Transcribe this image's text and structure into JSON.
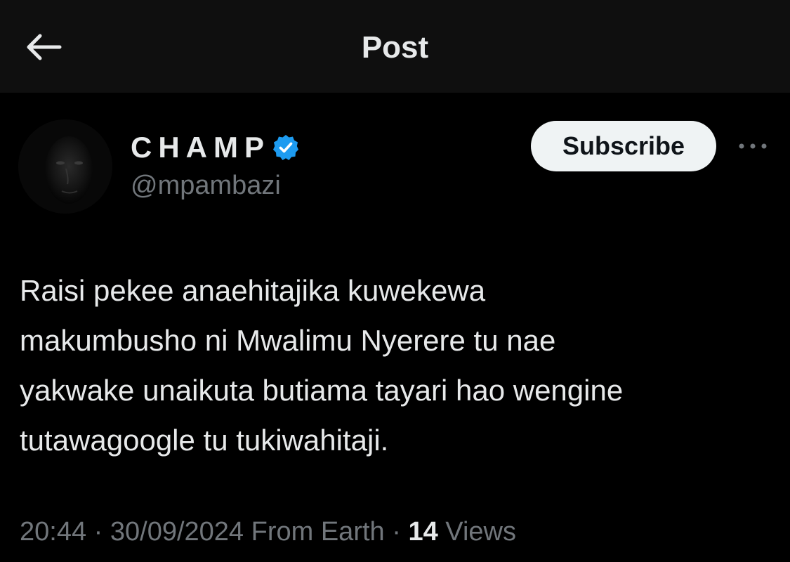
{
  "header": {
    "title": "Post",
    "back_icon": "arrow-left-icon"
  },
  "author": {
    "display_name": "CHAMP",
    "handle": "@mpambazi",
    "verified": true,
    "verified_color": "#1d9bf0",
    "avatar_icon": "avatar-image"
  },
  "actions": {
    "subscribe_label": "Subscribe",
    "more_icon": "more-horizontal-icon"
  },
  "post": {
    "text": "Raisi pekee anaehitajika kuwekewa\nmakumbusho ni Mwalimu Nyerere tu nae\nyakwake unaikuta butiama tayari hao wengine\ntutawagoogle tu tukiwahitaji."
  },
  "meta": {
    "time": "20:44",
    "separator": "·",
    "date": "30/09/2024",
    "source": "From Earth",
    "views_count": "14",
    "views_label": "Views"
  },
  "colors": {
    "background": "#000000",
    "header_background": "#0f0f0f",
    "primary_text": "#e7e9ea",
    "secondary_text": "#71767b",
    "button_background": "#eff3f4"
  }
}
